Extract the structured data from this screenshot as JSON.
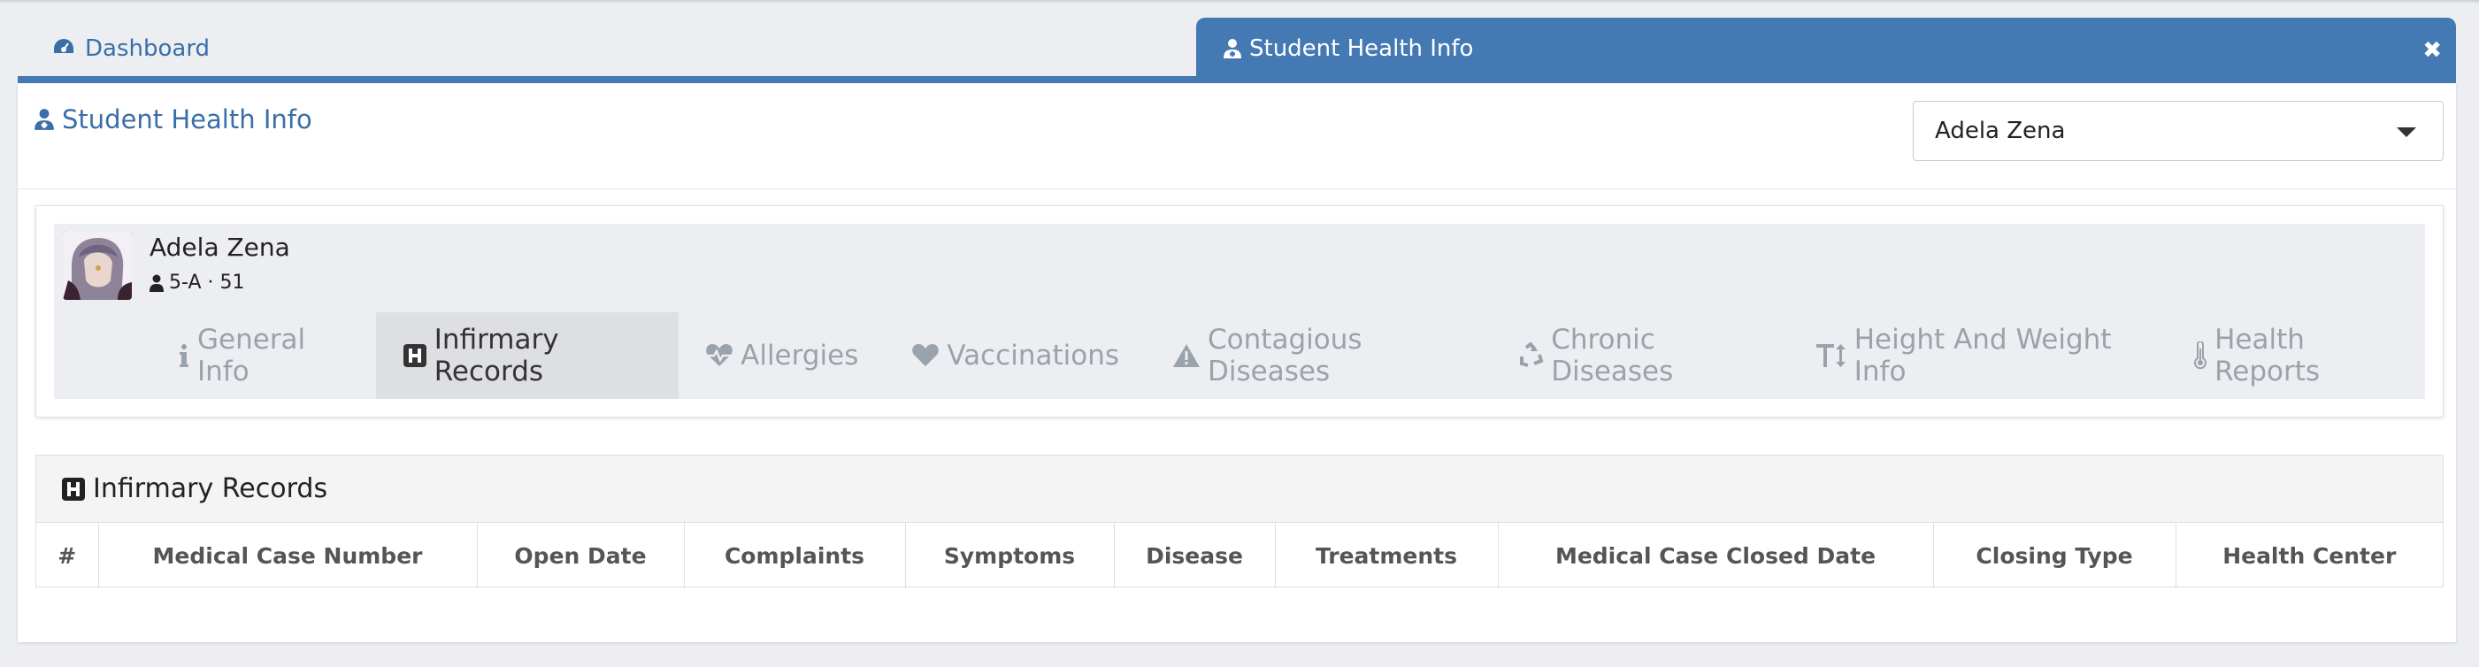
{
  "tabs": {
    "dashboard_label": "Dashboard",
    "active_label": "Student Health Info",
    "close_symbol": "✖"
  },
  "panel": {
    "title": "Student Health Info"
  },
  "student_select": {
    "selected": "Adela Zena"
  },
  "student": {
    "name": "Adela Zena",
    "class_info": "5-A · 51"
  },
  "subtabs": [
    {
      "label": "General Info",
      "icon": "info-icon"
    },
    {
      "label": "Infirmary Records",
      "icon": "hospital-icon"
    },
    {
      "label": "Allergies",
      "icon": "heartbeat-icon"
    },
    {
      "label": "Vaccinations",
      "icon": "heart-icon"
    },
    {
      "label": "Contagious Diseases",
      "icon": "warning-icon"
    },
    {
      "label": "Chronic Diseases",
      "icon": "recycle-icon"
    },
    {
      "label": "Height And Weight Info",
      "icon": "text-height-icon"
    },
    {
      "label": "Health Reports",
      "icon": "thermometer-icon"
    }
  ],
  "active_subtab": "Infirmary Records",
  "records": {
    "title": "Infirmary Records",
    "columns": [
      "#",
      "Medical Case Number",
      "Open Date",
      "Complaints",
      "Symptoms",
      "Disease",
      "Treatments",
      "Medical Case Closed Date",
      "Closing Type",
      "Health Center"
    ]
  },
  "colors": {
    "accent": "#4479b4",
    "link": "#3a6ea8",
    "muted": "#9aa2ab"
  }
}
